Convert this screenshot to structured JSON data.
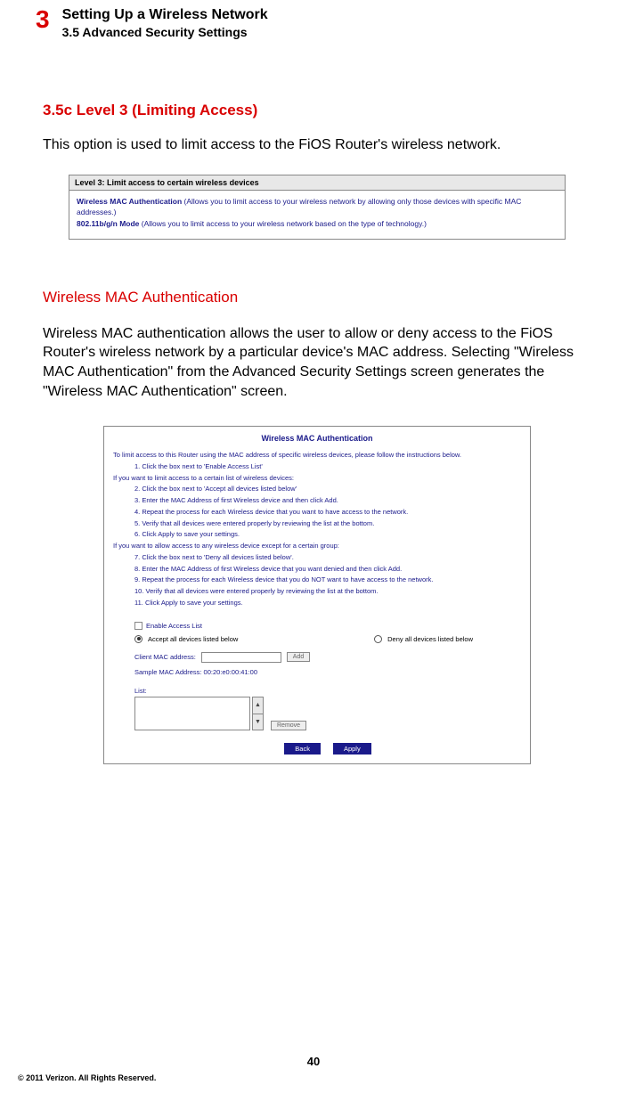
{
  "header": {
    "chapter_number": "3",
    "chapter_title": "Setting Up a Wireless Network",
    "section_title": "3.5  Advanced Security Settings"
  },
  "section": {
    "heading": "3.5c  Level 3 (Limiting Access)",
    "intro": "This option is used to limit access to the FiOS Router's wireless network."
  },
  "figure1": {
    "header": "Level 3: Limit access to certain wireless devices",
    "row1_bold": "Wireless MAC Authentication",
    "row1_rest": " (Allows you to limit access to your wireless network by allowing only those devices with specific MAC addresses.)",
    "row2_bold": "802.11b/g/n Mode",
    "row2_rest": " (Allows you to limit access to your wireless network based on the type of technology.)"
  },
  "mid": {
    "heading": "Wireless MAC Authentication",
    "paragraph": "Wireless MAC authentication allows the user to allow or deny access to the FiOS Router's wireless network by a particular device's MAC address. Selecting \"Wireless MAC Authentication\" from the Advanced Security Settings screen generates the \"Wireless MAC Authentication\" screen."
  },
  "figure2": {
    "title": "Wireless MAC Authentication",
    "line_intro": "To limit access to this Router using the MAC address of specific wireless devices, please follow the instructions below.",
    "step1": "1. Click the box next to 'Enable Access List'",
    "line_if1": "If you want to limit access to a certain list of wireless devices:",
    "step2": "2. Click the box next to 'Accept all devices listed below'",
    "step3": "3. Enter the MAC Address of first Wireless device and then click Add.",
    "step4": "4. Repeat the process for each Wireless device that you want to have access to the network.",
    "step5": "5. Verify that all devices were entered properly by reviewing the list at the bottom.",
    "step6": "6. Click Apply to save your settings.",
    "line_if2": "If you want to allow access to any wireless device except for a certain group:",
    "step7": "7. Click the box next to 'Deny all devices listed below'.",
    "step8": "8. Enter the MAC Address of first Wireless device that you want denied and then click Add.",
    "step9": "9. Repeat the process for each Wireless device that you do NOT want to have access to the network.",
    "step10": "10. Verify that all devices were entered properly by reviewing the list at the bottom.",
    "step11": "11. Click Apply to save your settings.",
    "enable_label": "Enable Access List",
    "radio_accept": "Accept all devices listed below",
    "radio_deny": "Deny all devices listed below",
    "client_label": "Client MAC address:",
    "add_btn": "Add",
    "sample": "Sample MAC Address: 00:20:e0:00:41:00",
    "list_label": "List:",
    "remove_btn": "Remove",
    "back_btn": "Back",
    "apply_btn": "Apply"
  },
  "footer": {
    "page_number": "40",
    "copyright": "© 2011 Verizon. All Rights Reserved."
  }
}
